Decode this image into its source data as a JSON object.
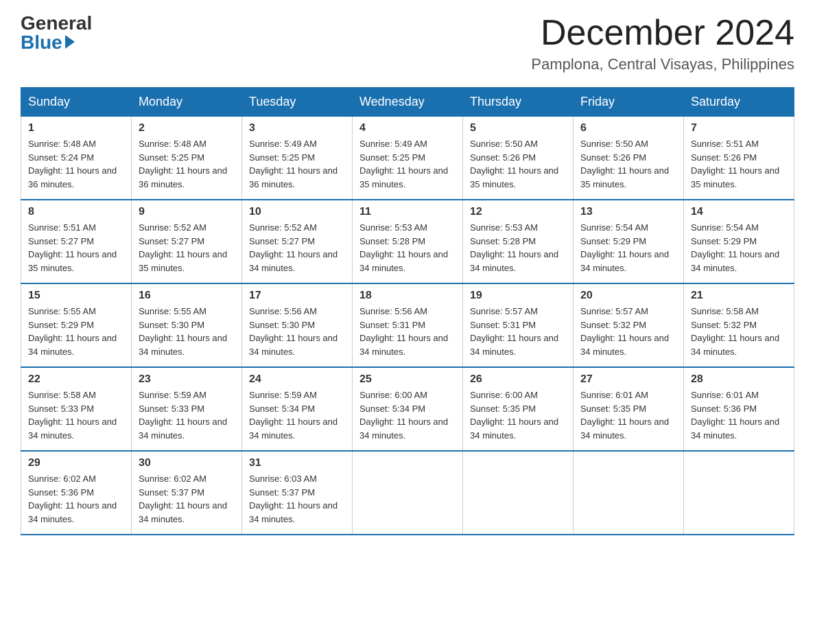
{
  "logo": {
    "general": "General",
    "blue": "Blue"
  },
  "title": "December 2024",
  "location": "Pamplona, Central Visayas, Philippines",
  "days_of_week": [
    "Sunday",
    "Monday",
    "Tuesday",
    "Wednesday",
    "Thursday",
    "Friday",
    "Saturday"
  ],
  "weeks": [
    [
      {
        "day": "1",
        "sunrise": "5:48 AM",
        "sunset": "5:24 PM",
        "daylight": "11 hours and 36 minutes."
      },
      {
        "day": "2",
        "sunrise": "5:48 AM",
        "sunset": "5:25 PM",
        "daylight": "11 hours and 36 minutes."
      },
      {
        "day": "3",
        "sunrise": "5:49 AM",
        "sunset": "5:25 PM",
        "daylight": "11 hours and 36 minutes."
      },
      {
        "day": "4",
        "sunrise": "5:49 AM",
        "sunset": "5:25 PM",
        "daylight": "11 hours and 35 minutes."
      },
      {
        "day": "5",
        "sunrise": "5:50 AM",
        "sunset": "5:26 PM",
        "daylight": "11 hours and 35 minutes."
      },
      {
        "day": "6",
        "sunrise": "5:50 AM",
        "sunset": "5:26 PM",
        "daylight": "11 hours and 35 minutes."
      },
      {
        "day": "7",
        "sunrise": "5:51 AM",
        "sunset": "5:26 PM",
        "daylight": "11 hours and 35 minutes."
      }
    ],
    [
      {
        "day": "8",
        "sunrise": "5:51 AM",
        "sunset": "5:27 PM",
        "daylight": "11 hours and 35 minutes."
      },
      {
        "day": "9",
        "sunrise": "5:52 AM",
        "sunset": "5:27 PM",
        "daylight": "11 hours and 35 minutes."
      },
      {
        "day": "10",
        "sunrise": "5:52 AM",
        "sunset": "5:27 PM",
        "daylight": "11 hours and 34 minutes."
      },
      {
        "day": "11",
        "sunrise": "5:53 AM",
        "sunset": "5:28 PM",
        "daylight": "11 hours and 34 minutes."
      },
      {
        "day": "12",
        "sunrise": "5:53 AM",
        "sunset": "5:28 PM",
        "daylight": "11 hours and 34 minutes."
      },
      {
        "day": "13",
        "sunrise": "5:54 AM",
        "sunset": "5:29 PM",
        "daylight": "11 hours and 34 minutes."
      },
      {
        "day": "14",
        "sunrise": "5:54 AM",
        "sunset": "5:29 PM",
        "daylight": "11 hours and 34 minutes."
      }
    ],
    [
      {
        "day": "15",
        "sunrise": "5:55 AM",
        "sunset": "5:29 PM",
        "daylight": "11 hours and 34 minutes."
      },
      {
        "day": "16",
        "sunrise": "5:55 AM",
        "sunset": "5:30 PM",
        "daylight": "11 hours and 34 minutes."
      },
      {
        "day": "17",
        "sunrise": "5:56 AM",
        "sunset": "5:30 PM",
        "daylight": "11 hours and 34 minutes."
      },
      {
        "day": "18",
        "sunrise": "5:56 AM",
        "sunset": "5:31 PM",
        "daylight": "11 hours and 34 minutes."
      },
      {
        "day": "19",
        "sunrise": "5:57 AM",
        "sunset": "5:31 PM",
        "daylight": "11 hours and 34 minutes."
      },
      {
        "day": "20",
        "sunrise": "5:57 AM",
        "sunset": "5:32 PM",
        "daylight": "11 hours and 34 minutes."
      },
      {
        "day": "21",
        "sunrise": "5:58 AM",
        "sunset": "5:32 PM",
        "daylight": "11 hours and 34 minutes."
      }
    ],
    [
      {
        "day": "22",
        "sunrise": "5:58 AM",
        "sunset": "5:33 PM",
        "daylight": "11 hours and 34 minutes."
      },
      {
        "day": "23",
        "sunrise": "5:59 AM",
        "sunset": "5:33 PM",
        "daylight": "11 hours and 34 minutes."
      },
      {
        "day": "24",
        "sunrise": "5:59 AM",
        "sunset": "5:34 PM",
        "daylight": "11 hours and 34 minutes."
      },
      {
        "day": "25",
        "sunrise": "6:00 AM",
        "sunset": "5:34 PM",
        "daylight": "11 hours and 34 minutes."
      },
      {
        "day": "26",
        "sunrise": "6:00 AM",
        "sunset": "5:35 PM",
        "daylight": "11 hours and 34 minutes."
      },
      {
        "day": "27",
        "sunrise": "6:01 AM",
        "sunset": "5:35 PM",
        "daylight": "11 hours and 34 minutes."
      },
      {
        "day": "28",
        "sunrise": "6:01 AM",
        "sunset": "5:36 PM",
        "daylight": "11 hours and 34 minutes."
      }
    ],
    [
      {
        "day": "29",
        "sunrise": "6:02 AM",
        "sunset": "5:36 PM",
        "daylight": "11 hours and 34 minutes."
      },
      {
        "day": "30",
        "sunrise": "6:02 AM",
        "sunset": "5:37 PM",
        "daylight": "11 hours and 34 minutes."
      },
      {
        "day": "31",
        "sunrise": "6:03 AM",
        "sunset": "5:37 PM",
        "daylight": "11 hours and 34 minutes."
      },
      null,
      null,
      null,
      null
    ]
  ],
  "labels": {
    "sunrise": "Sunrise: ",
    "sunset": "Sunset: ",
    "daylight": "Daylight: "
  }
}
